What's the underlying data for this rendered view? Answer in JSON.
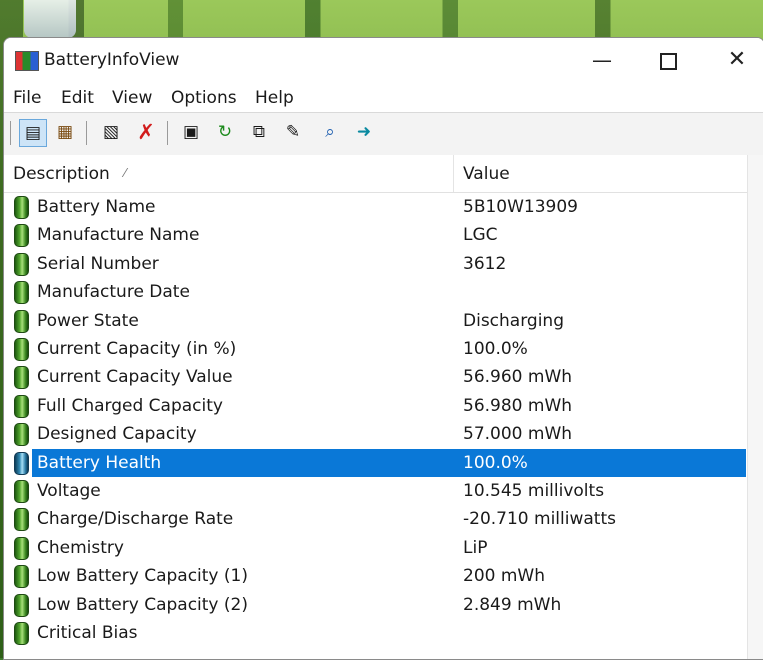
{
  "window": {
    "title": "BatteryInfoView"
  },
  "menu": [
    "File",
    "Edit",
    "View",
    "Options",
    "Help"
  ],
  "toolbar_icons": [
    "properties-icon",
    "html-report-icon",
    "show-all-icon",
    "delete-icon",
    "save-icon",
    "refresh-icon",
    "copy-icon",
    "properties-sheet-icon",
    "find-icon",
    "exit-icon"
  ],
  "columns": {
    "description": "Description",
    "value": "Value"
  },
  "rows": [
    {
      "description": "Battery Name",
      "value": "5B10W13909"
    },
    {
      "description": "Manufacture Name",
      "value": "LGC"
    },
    {
      "description": "Serial Number",
      "value": " 3612"
    },
    {
      "description": "Manufacture Date",
      "value": ""
    },
    {
      "description": "Power State",
      "value": "Discharging"
    },
    {
      "description": "Current Capacity (in %)",
      "value": "100.0%"
    },
    {
      "description": "Current Capacity Value",
      "value": "56.960 mWh"
    },
    {
      "description": "Full Charged Capacity",
      "value": "56.980 mWh"
    },
    {
      "description": "Designed Capacity",
      "value": "57.000 mWh"
    },
    {
      "description": "Battery Health",
      "value": "100.0%",
      "selected": true
    },
    {
      "description": "Voltage",
      "value": "10.545 millivolts"
    },
    {
      "description": "Charge/Discharge Rate",
      "value": "-20.710 milliwatts"
    },
    {
      "description": "Chemistry",
      "value": "LiP"
    },
    {
      "description": "Low Battery Capacity (1)",
      "value": "200 mWh"
    },
    {
      "description": "Low Battery Capacity (2)",
      "value": "2.849 mWh"
    },
    {
      "description": "Critical Bias",
      "value": ""
    }
  ],
  "colors": {
    "selection": "#0a78d7",
    "battery_icon": "#3d8a22"
  }
}
